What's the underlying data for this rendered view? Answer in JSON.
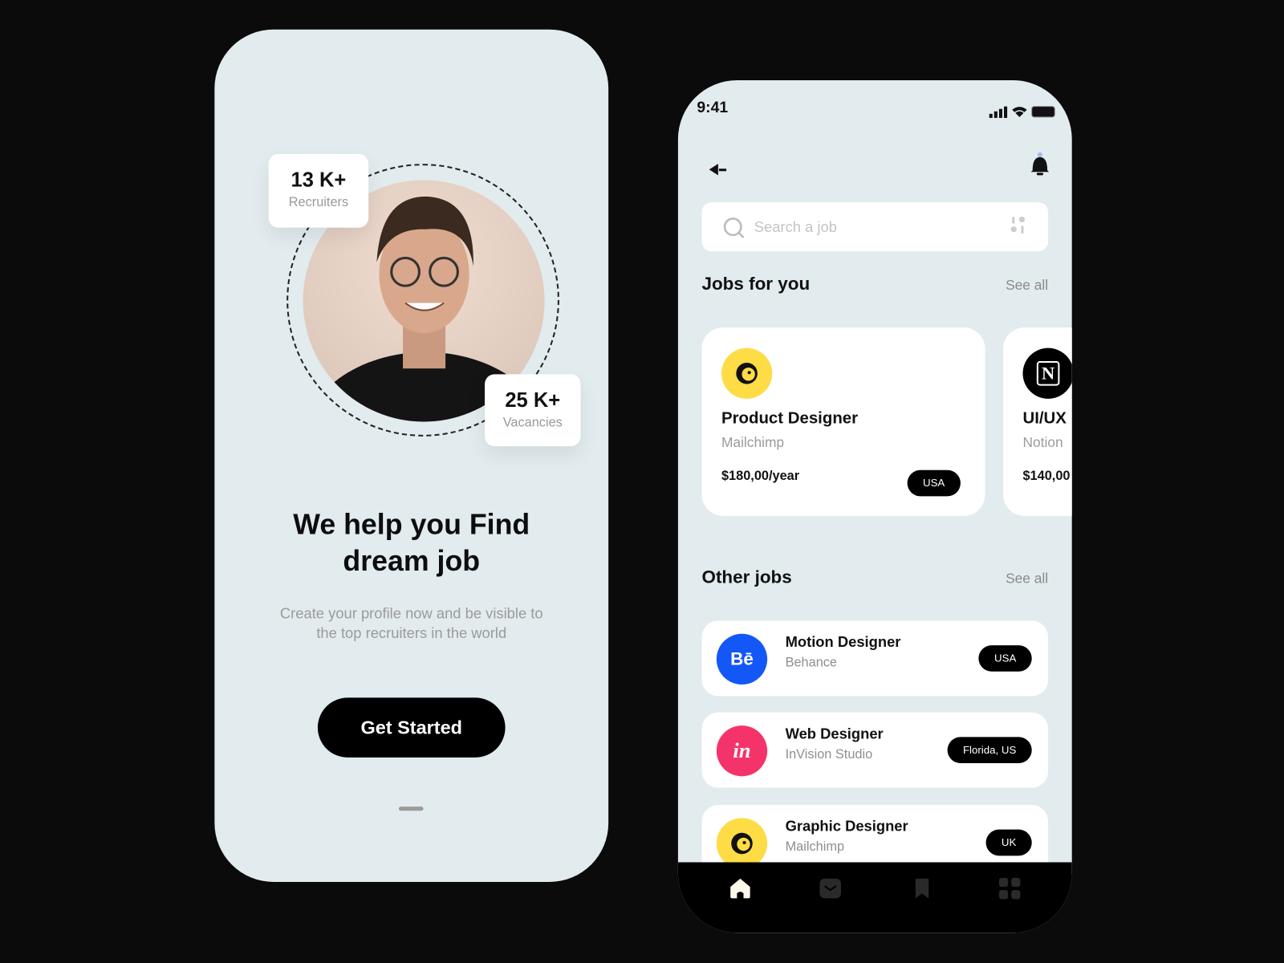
{
  "onboarding": {
    "stats": [
      {
        "value": "13 K+",
        "label": "Recruiters"
      },
      {
        "value": "25 K+",
        "label": "Vacancies"
      }
    ],
    "headline": "We help you Find dream job",
    "subtitle": "Create your profile now and be visible to the top recruiters in the world",
    "cta_label": "Get Started"
  },
  "home": {
    "status_time": "9:41",
    "search_placeholder": "Search a job",
    "jobs_for_you": {
      "title": "Jobs for you",
      "see_all": "See all",
      "cards": [
        {
          "title": "Product Designer",
          "company": "Mailchimp",
          "salary": "$180,00/year",
          "location": "USA",
          "logo_color": "#fedc45"
        },
        {
          "title": "UI/UX",
          "company": "Notion",
          "salary": "$140,00",
          "logo_color": "#000000"
        }
      ]
    },
    "other_jobs": {
      "title": "Other jobs",
      "see_all": "See all",
      "items": [
        {
          "title": "Motion Designer",
          "company": "Behance",
          "location": "USA",
          "logo_text": "Bē",
          "logo_color": "#1357f7"
        },
        {
          "title": "Web Designer",
          "company": "InVision Studio",
          "location": "Florida, US",
          "logo_text": "in",
          "logo_color": "#f5336b"
        },
        {
          "title": "Graphic Designer",
          "company": "Mailchimp",
          "location": "UK",
          "logo_color": "#fedc45"
        }
      ]
    },
    "nav": [
      "home",
      "messages",
      "saved",
      "menu"
    ]
  }
}
